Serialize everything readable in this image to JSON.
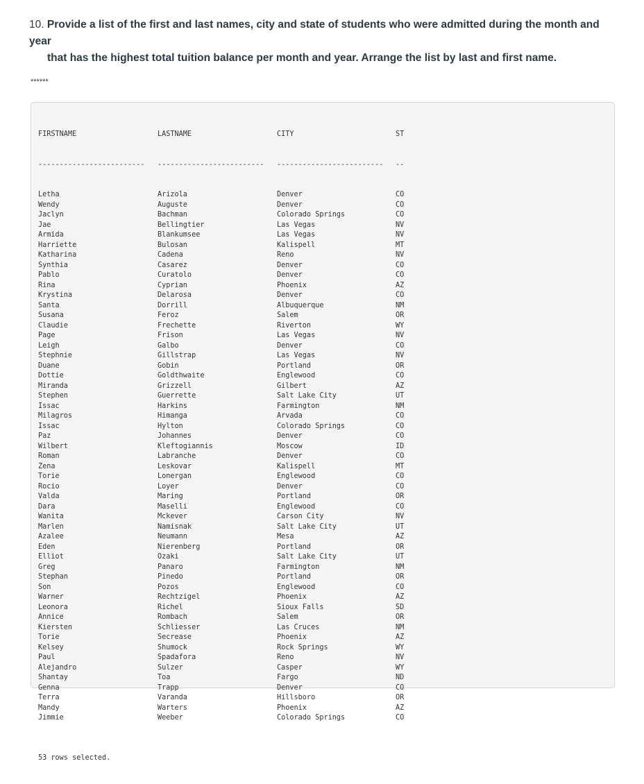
{
  "question": {
    "number": "10.",
    "line1": "Provide a list of the first and last names, city and state of students who were admitted during the month and year",
    "line2": "that has the highest total tuition balance per month and year. Arrange the list by last and first name."
  },
  "separator": "******",
  "result": {
    "columns": [
      "FIRSTNAME",
      "LASTNAME",
      "CITY",
      "ST"
    ],
    "underlines": [
      "-------------------------",
      "-------------------------",
      "-------------------------",
      "--"
    ],
    "rows": [
      [
        "Letha",
        "Arizola",
        "Denver",
        "CO"
      ],
      [
        "Wendy",
        "Auguste",
        "Denver",
        "CO"
      ],
      [
        "Jaclyn",
        "Bachman",
        "Colorado Springs",
        "CO"
      ],
      [
        "Jae",
        "Bellingtier",
        "Las Vegas",
        "NV"
      ],
      [
        "Armida",
        "Blankumsee",
        "Las Vegas",
        "NV"
      ],
      [
        "Harriette",
        "Bulosan",
        "Kalispell",
        "MT"
      ],
      [
        "Katharina",
        "Cadena",
        "Reno",
        "NV"
      ],
      [
        "Synthia",
        "Casarez",
        "Denver",
        "CO"
      ],
      [
        "Pablo",
        "Curatolo",
        "Denver",
        "CO"
      ],
      [
        "Rina",
        "Cyprian",
        "Phoenix",
        "AZ"
      ],
      [
        "Krystina",
        "Delarosa",
        "Denver",
        "CO"
      ],
      [
        "Santa",
        "Dorrill",
        "Albuquerque",
        "NM"
      ],
      [
        "Susana",
        "Feroz",
        "Salem",
        "OR"
      ],
      [
        "Claudie",
        "Frechette",
        "Riverton",
        "WY"
      ],
      [
        "Page",
        "Frison",
        "Las Vegas",
        "NV"
      ],
      [
        "Leigh",
        "Galbo",
        "Denver",
        "CO"
      ],
      [
        "Stephnie",
        "Gillstrap",
        "Las Vegas",
        "NV"
      ],
      [
        "Duane",
        "Gobin",
        "Portland",
        "OR"
      ],
      [
        "Dottie",
        "Goldthwaite",
        "Englewood",
        "CO"
      ],
      [
        "Miranda",
        "Grizzell",
        "Gilbert",
        "AZ"
      ],
      [
        "Stephen",
        "Guerrette",
        "Salt Lake City",
        "UT"
      ],
      [
        "Issac",
        "Harkins",
        "Farmington",
        "NM"
      ],
      [
        "Milagros",
        "Himanga",
        "Arvada",
        "CO"
      ],
      [
        "Issac",
        "Hylton",
        "Colorado Springs",
        "CO"
      ],
      [
        "Paz",
        "Johannes",
        "Denver",
        "CO"
      ],
      [
        "Wilbert",
        "Kleftogiannis",
        "Moscow",
        "ID"
      ],
      [
        "Roman",
        "Labranche",
        "Denver",
        "CO"
      ],
      [
        "Zena",
        "Leskovar",
        "Kalispell",
        "MT"
      ],
      [
        "Torie",
        "Lonergan",
        "Englewood",
        "CO"
      ],
      [
        "Rocio",
        "Loyer",
        "Denver",
        "CO"
      ],
      [
        "Valda",
        "Maring",
        "Portland",
        "OR"
      ],
      [
        "Dara",
        "Maselli",
        "Englewood",
        "CO"
      ],
      [
        "Wanita",
        "Mckever",
        "Carson City",
        "NV"
      ],
      [
        "Marlen",
        "Namisnak",
        "Salt Lake City",
        "UT"
      ],
      [
        "Azalee",
        "Neumann",
        "Mesa",
        "AZ"
      ],
      [
        "Eden",
        "Nierenberg",
        "Portland",
        "OR"
      ],
      [
        "Elliot",
        "Ozaki",
        "Salt Lake City",
        "UT"
      ],
      [
        "Greg",
        "Panaro",
        "Farmington",
        "NM"
      ],
      [
        "Stephan",
        "Pinedo",
        "Portland",
        "OR"
      ],
      [
        "Son",
        "Pozos",
        "Englewood",
        "CO"
      ],
      [
        "Warner",
        "Rechtzigel",
        "Phoenix",
        "AZ"
      ],
      [
        "Leonora",
        "Richel",
        "Sioux Falls",
        "SD"
      ],
      [
        "Annice",
        "Rombach",
        "Salem",
        "OR"
      ],
      [
        "Kiersten",
        "Schliesser",
        "Las Cruces",
        "NM"
      ],
      [
        "Torie",
        "Secrease",
        "Phoenix",
        "AZ"
      ],
      [
        "Kelsey",
        "Shumock",
        "Rock Springs",
        "WY"
      ],
      [
        "Paul",
        "Spadafora",
        "Reno",
        "NV"
      ],
      [
        "Alejandro",
        "Sulzer",
        "Casper",
        "WY"
      ],
      [
        "Shantay",
        "Toa",
        "Fargo",
        "ND"
      ],
      [
        "Genna",
        "Trapp",
        "Denver",
        "CO"
      ],
      [
        "Terra",
        "Varanda",
        "Hillsboro",
        "OR"
      ],
      [
        "Mandy",
        "Warters",
        "Phoenix",
        "AZ"
      ],
      [
        "Jimmie",
        "Weeber",
        "Colorado Springs",
        "CO"
      ]
    ],
    "footer": "53 rows selected."
  }
}
